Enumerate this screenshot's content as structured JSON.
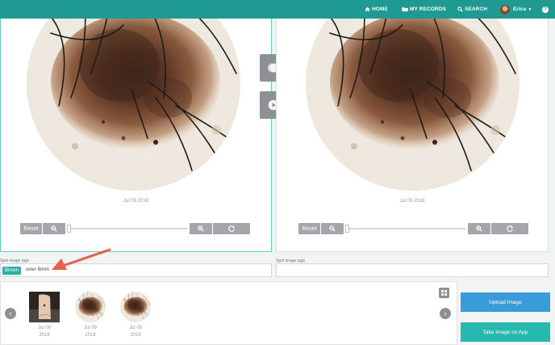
{
  "nav": {
    "home_label": "HOME",
    "records_label": "MY RECORDS",
    "search_label": "SEARCH",
    "user_name": "Erica",
    "help_label": "?"
  },
  "viewer_left": {
    "date": "Jul 09 2018",
    "reset_label": "Reset",
    "zoom_level": 0
  },
  "viewer_right": {
    "date": "Jul 09 2018",
    "reset_label": "Reset",
    "zoom_level": 0
  },
  "tags_left": {
    "label": "Spot image tags",
    "chips": [
      "Brown"
    ],
    "input_value": "over 6mm"
  },
  "tags_right": {
    "label": "Spot image tags",
    "input_value": ""
  },
  "thumbnails": [
    {
      "date_line1": "Jul 09",
      "date_line2": "2018",
      "kind": "photo"
    },
    {
      "date_line1": "Jul 09",
      "date_line2": "2018",
      "kind": "dermoscopy"
    },
    {
      "date_line1": "Jul 09",
      "date_line2": "2018",
      "kind": "dermoscopy"
    }
  ],
  "actions": {
    "upload_label": "Upload Image",
    "take_app_label": "Take Image on App"
  },
  "colors": {
    "navbar": "#1e9a92",
    "tag_chip": "#23b3aa",
    "upload_button": "#3a9bd9",
    "take_app_button": "#27b8ae",
    "arrow": "#e8604c"
  }
}
